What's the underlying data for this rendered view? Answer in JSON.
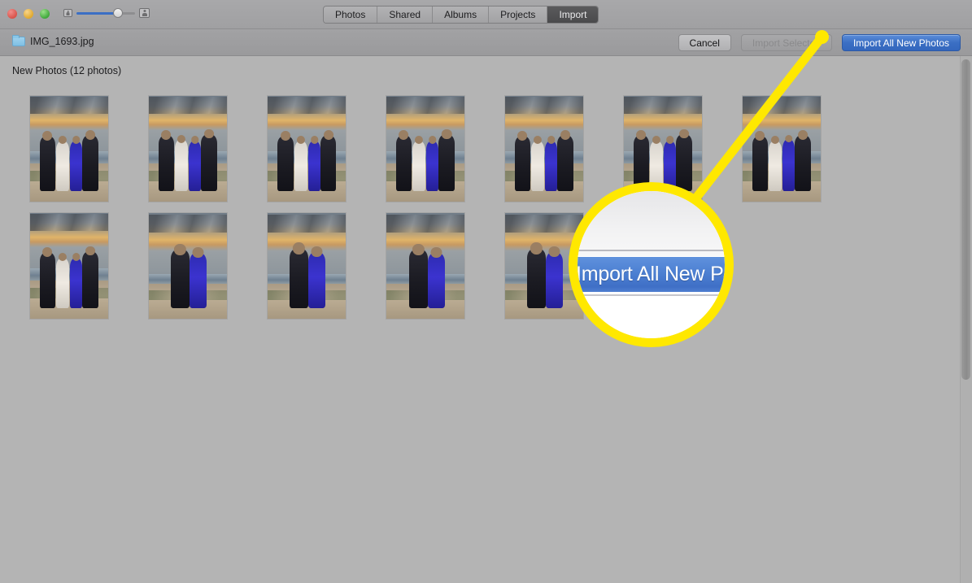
{
  "window": {
    "traffic_lights": [
      {
        "name": "close",
        "color": "#d9534a"
      },
      {
        "name": "minimize",
        "color": "#e0a92f"
      },
      {
        "name": "zoom",
        "color": "#3fa83a"
      }
    ],
    "zoom_slider": {
      "small_icon": "small-thumbnail-icon",
      "large_icon": "large-thumbnail-icon",
      "value": 62
    }
  },
  "tabs": [
    {
      "label": "Photos",
      "active": false
    },
    {
      "label": "Shared",
      "active": false
    },
    {
      "label": "Albums",
      "active": false
    },
    {
      "label": "Projects",
      "active": false
    },
    {
      "label": "Import",
      "active": true
    }
  ],
  "toolbar": {
    "folder_icon": "folder-icon",
    "file_name": "IMG_1693.jpg",
    "cancel_label": "Cancel",
    "import_selected_label": "Import Selected",
    "import_selected_disabled": true,
    "import_all_label": "Import All New Photos",
    "accent_color": "#3b6fc4"
  },
  "content": {
    "section_title": "New Photos (12 photos)",
    "photo_count": 12,
    "photos": [
      {
        "id": 1,
        "row": 1,
        "kind": "group-four-sunset"
      },
      {
        "id": 2,
        "row": 1,
        "kind": "group-four-sunset"
      },
      {
        "id": 3,
        "row": 1,
        "kind": "group-four-sunset"
      },
      {
        "id": 4,
        "row": 1,
        "kind": "group-four-sunset"
      },
      {
        "id": 5,
        "row": 1,
        "kind": "group-four-sunset"
      },
      {
        "id": 6,
        "row": 1,
        "kind": "group-four-sunset"
      },
      {
        "id": 7,
        "row": 1,
        "kind": "group-four-sunset"
      },
      {
        "id": 8,
        "row": 1,
        "kind": "group-four-sunset"
      },
      {
        "id": 9,
        "row": 2,
        "kind": "couple-sunset"
      },
      {
        "id": 10,
        "row": 2,
        "kind": "couple-sunset"
      },
      {
        "id": 11,
        "row": 2,
        "kind": "couple-sunset"
      },
      {
        "id": 12,
        "row": 2,
        "kind": "couple-sunset"
      }
    ]
  },
  "callout": {
    "highlight_color": "#ffe800",
    "magnified_text": "Import All New Photo",
    "target": "import-all-new-photos-button"
  },
  "scrollbar": {
    "orientation": "vertical",
    "thumb_position": "top"
  }
}
